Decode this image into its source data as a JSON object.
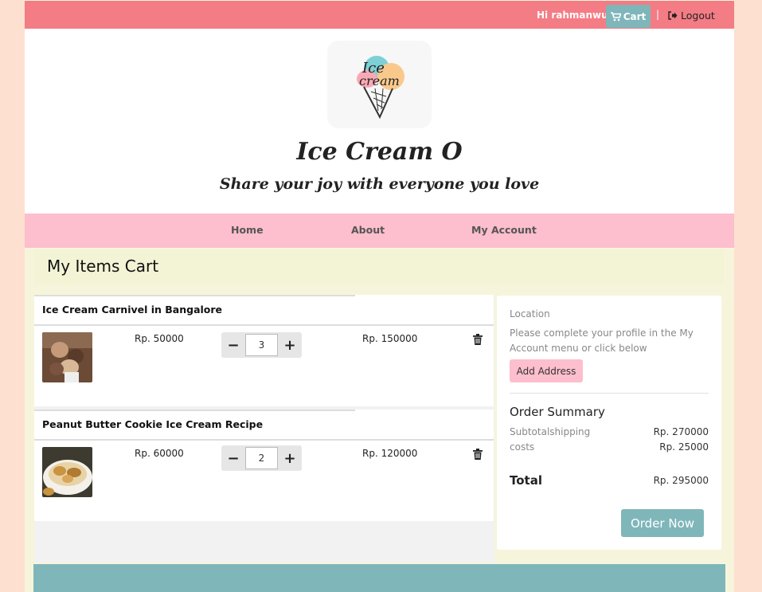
{
  "topbar": {
    "greeting": "Hi rahmanwu",
    "cart_label": "Cart",
    "separator": "|",
    "logout_label": "Logout"
  },
  "header": {
    "logo_text_1": "Ice",
    "logo_text_2": "cream",
    "title": "Ice Cream O",
    "tagline": "Share your joy with everyone you love"
  },
  "nav": {
    "items": [
      "Home",
      "About",
      "My Account"
    ]
  },
  "cart": {
    "heading": "My Items Cart",
    "items": [
      {
        "name": "Ice Cream Carnivel in Bangalore",
        "price": "Rp. 50000",
        "qty": "3",
        "total": "Rp. 150000"
      },
      {
        "name": "Peanut Butter Cookie Ice Cream Recipe",
        "price": "Rp. 60000",
        "qty": "2",
        "total": "Rp. 120000"
      }
    ]
  },
  "summary": {
    "location_label": "Location",
    "location_text": "Please complete your profile in the My Account menu or click below",
    "add_address": "Add Address",
    "order_summary": "Order Summary",
    "subtotal_label": "Subtotal",
    "shipping_label": "shipping costs",
    "subtotal_value": "Rp. 270000",
    "shipping_value": "Rp. 25000",
    "total_label": "Total",
    "total_value": "Rp. 295000",
    "order_now": "Order Now"
  },
  "colors": {
    "topbar": "#f47c84",
    "nav": "#fdbecd",
    "accent": "#7fb6ba",
    "outer_bg": "#fde0d0"
  }
}
